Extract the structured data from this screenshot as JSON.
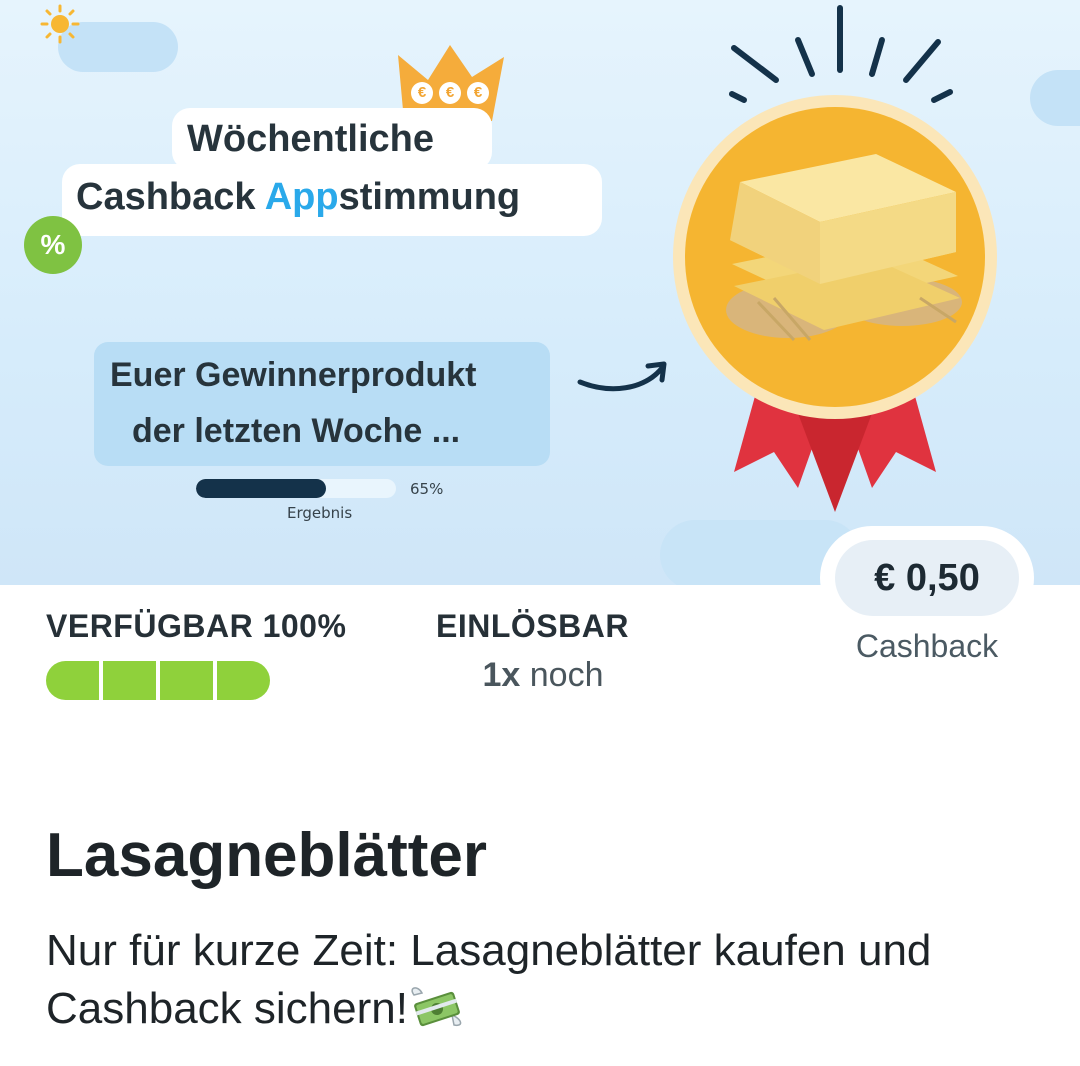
{
  "banner": {
    "headline_line1": "Wöchentliche",
    "headline_line2_pre": "Cashback ",
    "headline_line2_accent": "App",
    "headline_line2_post": "stimmung",
    "crown_euros": [
      "€",
      "€",
      "€"
    ],
    "percent_badge": "%",
    "winner_line1": "Euer Gewinnerprodukt",
    "winner_line2": "der letzten Woche ...",
    "result_progress": 0.65,
    "result_percent": "65%",
    "result_label": "Ergebnis",
    "icons": [
      "sun-icon",
      "crown-icon",
      "arrow-icon",
      "medal-icon",
      "lasagne-image"
    ]
  },
  "cashback": {
    "amount": "€ 0,50",
    "label": "Cashback"
  },
  "availability": {
    "label": "VERFÜGBAR 100%",
    "level": 1.0,
    "segments": 4
  },
  "redeemable": {
    "label": "EINLÖSBAR",
    "count": "1x",
    "suffix": " noch"
  },
  "product": {
    "title": "Lasagneblätter",
    "description": "Nur für kurze Zeit: Lasagneblätter kaufen und Cashback sichern!",
    "emoji_icon": "money-with-wings-icon"
  },
  "colors": {
    "accent_blue": "#2aa9ea",
    "availability_green": "#8fd13b",
    "badge_green": "#7fc242",
    "crown_orange": "#f2a533",
    "medal_orange": "#f5b531",
    "ribbon_red": "#e0333f",
    "progress_navy": "#14324a"
  }
}
